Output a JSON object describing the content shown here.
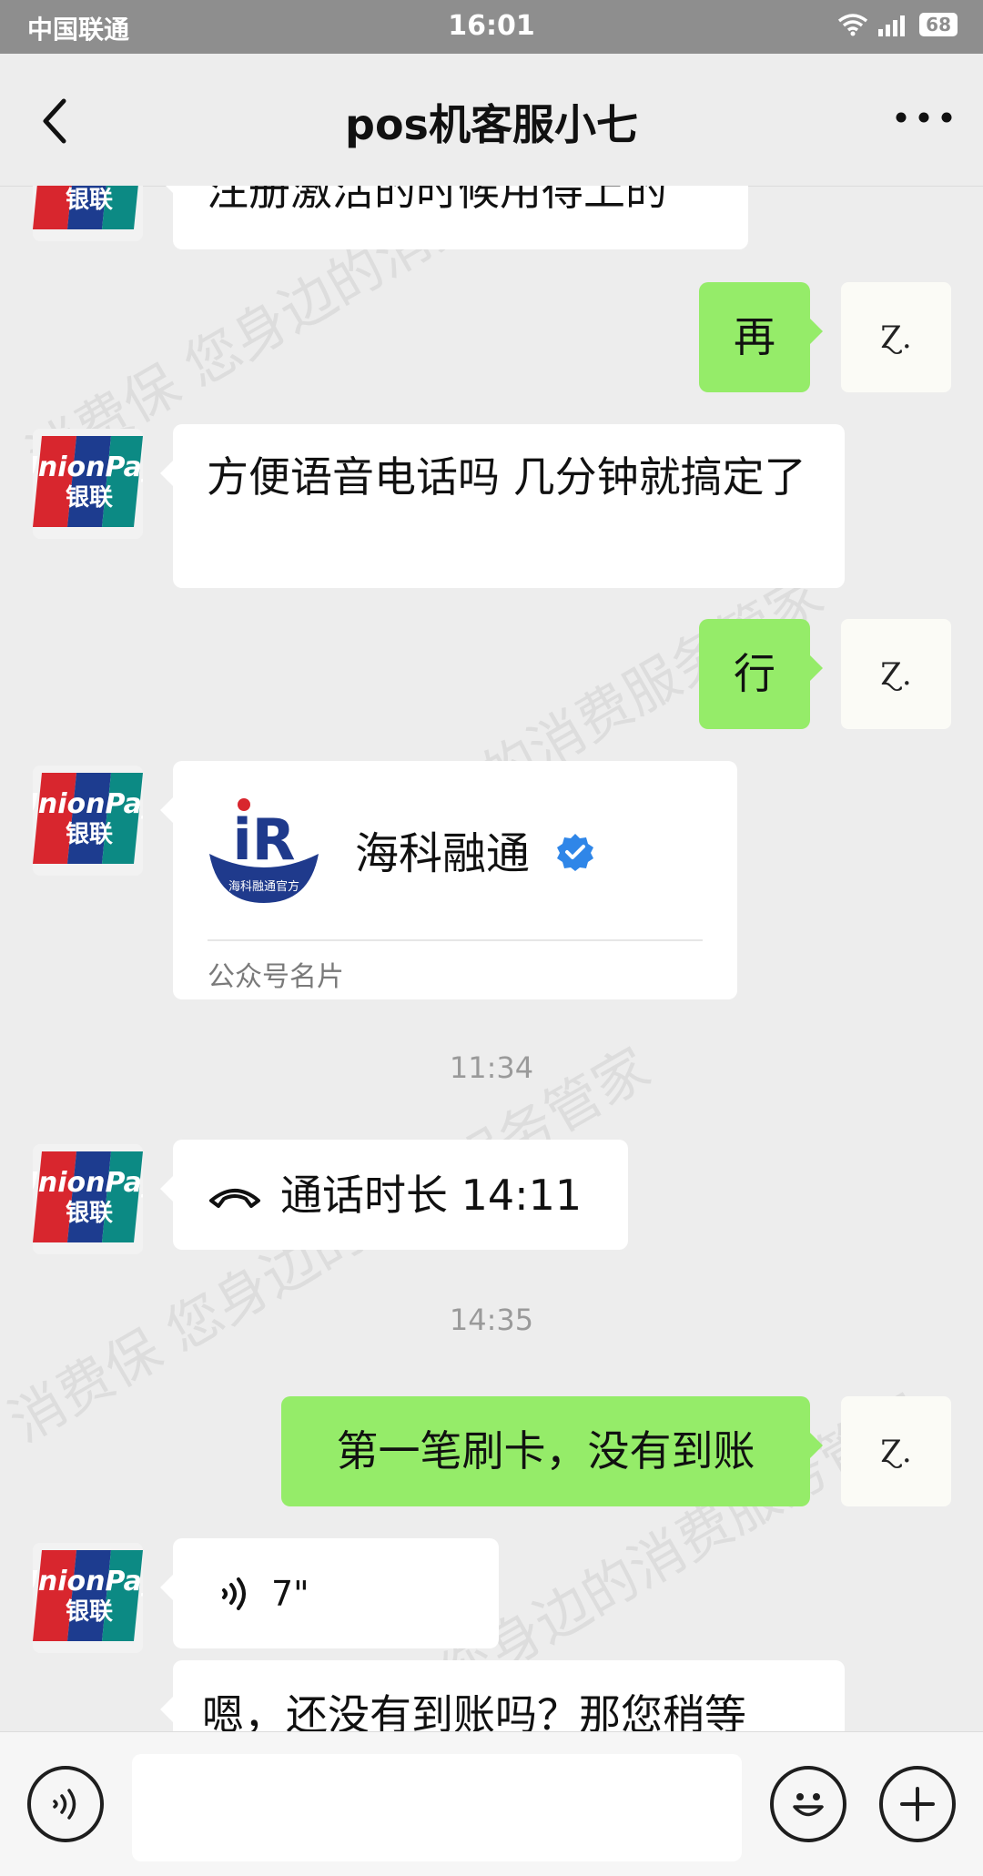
{
  "status_bar": {
    "carrier": "中国联通",
    "time": "16:01",
    "battery": "68"
  },
  "header": {
    "title": "pos机客服小七"
  },
  "me_avatar_text": "Ɀ.",
  "other_avatar": {
    "line1": "UnionPay",
    "line2": "银联"
  },
  "messages": [
    {
      "side": "left",
      "text": "注册激活的时候用得上的"
    },
    {
      "side": "right",
      "text": "再"
    },
    {
      "side": "left",
      "text": "方便语音电话吗 几分钟就搞定了"
    },
    {
      "side": "right",
      "text": "行"
    },
    {
      "side": "left",
      "type": "card",
      "logo_text": "iR",
      "logo_sub": "海科融通官方",
      "name": "海科融通",
      "footer": "公众号名片"
    },
    {
      "type": "timestamp",
      "text": "11:34"
    },
    {
      "side": "left",
      "type": "call",
      "text": "通话时长 14:11"
    },
    {
      "type": "timestamp",
      "text": "14:35"
    },
    {
      "side": "right",
      "text": "第一笔刷卡，没有到账"
    },
    {
      "side": "left",
      "type": "voice",
      "duration": "7\""
    },
    {
      "side": "left",
      "text": "嗯，还没有到账吗？那您稍等"
    }
  ],
  "watermark": "消费保 您身边的消费服务管家",
  "colors": {
    "bubble_right": "#95ec69",
    "bubble_left": "#ffffff",
    "background": "#ededed",
    "status_bar": "#8e8e8e"
  }
}
